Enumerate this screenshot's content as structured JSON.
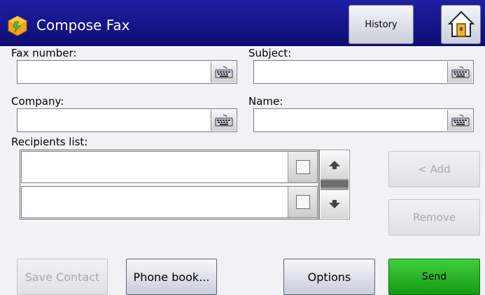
{
  "header": {
    "title": "Compose Fax",
    "history_label": "History",
    "app_icon": "fax-app-icon",
    "home_icon": "home-icon"
  },
  "form": {
    "fax_number_label": "Fax number:",
    "fax_number_value": "",
    "subject_label": "Subject:",
    "subject_value": "",
    "company_label": "Company:",
    "company_value": "",
    "name_label": "Name:",
    "name_value": "",
    "keyboard_icon": "keyboard-icon"
  },
  "recipients": {
    "label": "Recipients list:",
    "rows": [
      {
        "text": "",
        "checked": false
      },
      {
        "text": "",
        "checked": false
      }
    ],
    "scroll_up_icon": "arrow-up-icon",
    "scroll_down_icon": "arrow-down-icon"
  },
  "actions": {
    "add_label": "< Add",
    "remove_label": "Remove",
    "save_contact_label": "Save Contact",
    "phone_book_label": "Phone book...",
    "options_label": "Options",
    "send_label": "Send"
  },
  "colors": {
    "titlebar": "#15158a",
    "send": "#1fae1c",
    "disabled_text": "#a6a9b1"
  }
}
